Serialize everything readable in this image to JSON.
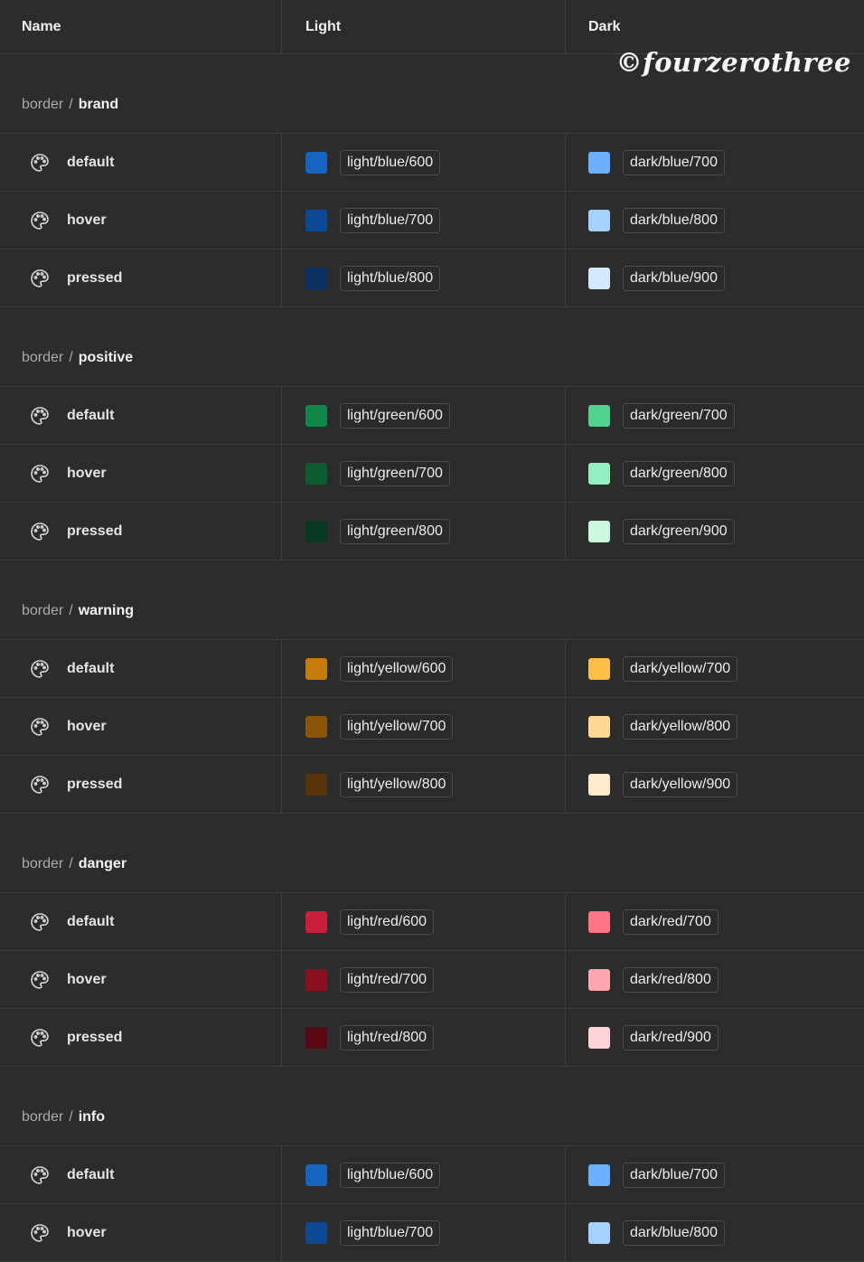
{
  "columns": {
    "name": "Name",
    "light": "Light",
    "dark": "Dark"
  },
  "watermark": "©fourzerothree",
  "group_prefix": "border",
  "group_separator": "/",
  "groups": [
    {
      "name": "brand",
      "rows": [
        {
          "state": "default",
          "light": "light/blue/600",
          "light_color": "#1565c0",
          "dark": "dark/blue/700",
          "dark_color": "#6cb1ff"
        },
        {
          "state": "hover",
          "light": "light/blue/700",
          "light_color": "#0d4a96",
          "dark": "dark/blue/800",
          "dark_color": "#a6d0ff"
        },
        {
          "state": "pressed",
          "light": "light/blue/800",
          "light_color": "#0a2f61",
          "dark": "dark/blue/900",
          "dark_color": "#d4e8ff"
        }
      ]
    },
    {
      "name": "positive",
      "rows": [
        {
          "state": "default",
          "light": "light/green/600",
          "light_color": "#10864a",
          "dark": "dark/green/700",
          "dark_color": "#4fd38e"
        },
        {
          "state": "hover",
          "light": "light/green/700",
          "light_color": "#0b5c33",
          "dark": "dark/green/800",
          "dark_color": "#93efc0"
        },
        {
          "state": "pressed",
          "light": "light/green/800",
          "light_color": "#083a22",
          "dark": "dark/green/900",
          "dark_color": "#c9f8de"
        }
      ]
    },
    {
      "name": "warning",
      "rows": [
        {
          "state": "default",
          "light": "light/yellow/600",
          "light_color": "#c67c0a",
          "dark": "dark/yellow/700",
          "dark_color": "#ffbd45"
        },
        {
          "state": "hover",
          "light": "light/yellow/700",
          "light_color": "#8a540b",
          "dark": "dark/yellow/800",
          "dark_color": "#ffd893"
        },
        {
          "state": "pressed",
          "light": "light/yellow/800",
          "light_color": "#573509",
          "dark": "dark/yellow/900",
          "dark_color": "#ffecca"
        }
      ]
    },
    {
      "name": "danger",
      "rows": [
        {
          "state": "default",
          "light": "light/red/600",
          "light_color": "#c8203b",
          "dark": "dark/red/700",
          "dark_color": "#ff7487"
        },
        {
          "state": "hover",
          "light": "light/red/700",
          "light_color": "#8a0f1f",
          "dark": "dark/red/800",
          "dark_color": "#ffa6b1"
        },
        {
          "state": "pressed",
          "light": "light/red/800",
          "light_color": "#5a0913",
          "dark": "dark/red/900",
          "dark_color": "#ffd2d8"
        }
      ]
    },
    {
      "name": "info",
      "rows": [
        {
          "state": "default",
          "light": "light/blue/600",
          "light_color": "#1565c0",
          "dark": "dark/blue/700",
          "dark_color": "#6cb1ff"
        },
        {
          "state": "hover",
          "light": "light/blue/700",
          "light_color": "#0d4a96",
          "dark": "dark/blue/800",
          "dark_color": "#a6d0ff"
        }
      ]
    }
  ]
}
